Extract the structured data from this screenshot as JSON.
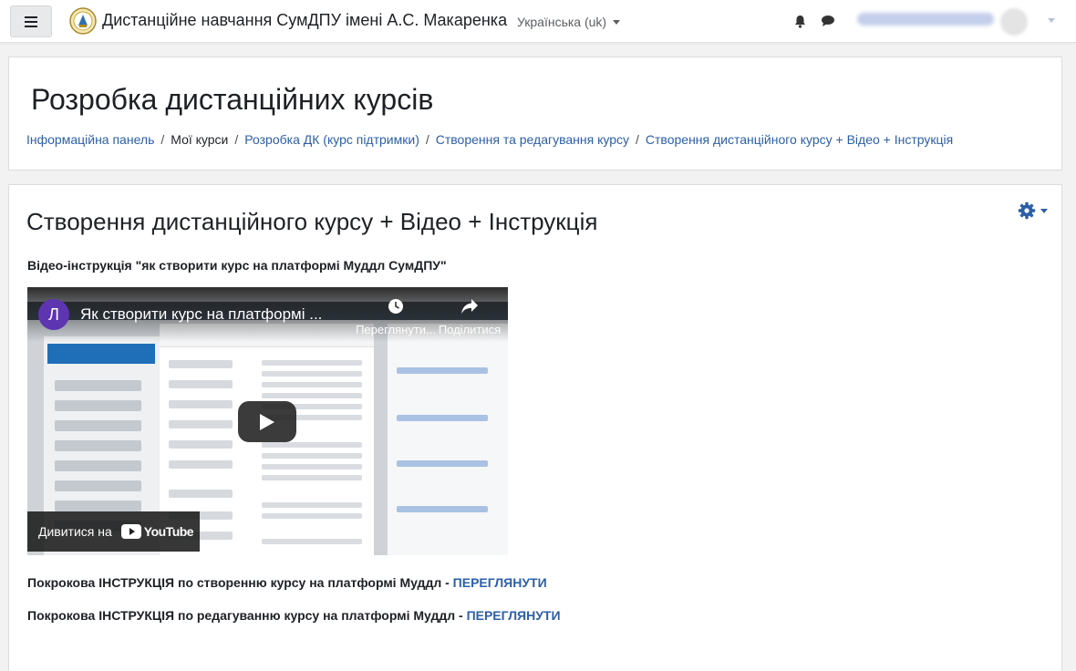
{
  "navbar": {
    "site_name": "Дистанційне навчання СумДПУ імені А.С. Макаренка",
    "language": "Українська (uk)",
    "icons": {
      "menu": "hamburger-icon",
      "notifications": "bell-icon",
      "messages": "chat-icon",
      "user_menu": "chevron-down-icon"
    }
  },
  "header": {
    "title": "Розробка дистанційних курсів",
    "breadcrumb": [
      {
        "label": "Інформаційна панель",
        "link": true
      },
      {
        "label": "Мої курси",
        "link": false
      },
      {
        "label": "Розробка ДК (курс підтримки)",
        "link": true
      },
      {
        "label": "Створення та редагування курсу",
        "link": true
      },
      {
        "label": "Створення дистанційного курсу + Відео + Інструкція",
        "link": true
      }
    ]
  },
  "main": {
    "title": "Створення дистанційного курсу + Відео + Інструкція",
    "video_heading": "Відео-інструкція \"як створити курс на платформі Муддл СумДПУ\"",
    "video": {
      "channel_initial": "Л",
      "title": "Як створити курс на платформі ...",
      "watch_later": "Переглянути...",
      "share": "Поділитися",
      "watch_on": "Дивитися на",
      "youtube": "YouTube"
    },
    "instructions": [
      {
        "text": "Покрокова ІНСТРУКЦІЯ по створенню курсу на платформі Муддл - ",
        "link": "ПЕРЕГЛЯНУТИ"
      },
      {
        "text": "Покрокова ІНСТРУКЦІЯ по редагуванню курсу на платформі Муддл - ",
        "link": "ПЕРЕГЛЯНУТИ"
      }
    ]
  },
  "colors": {
    "link": "#2c5fa8",
    "text": "#1d2125",
    "background": "#f2f2f2"
  }
}
